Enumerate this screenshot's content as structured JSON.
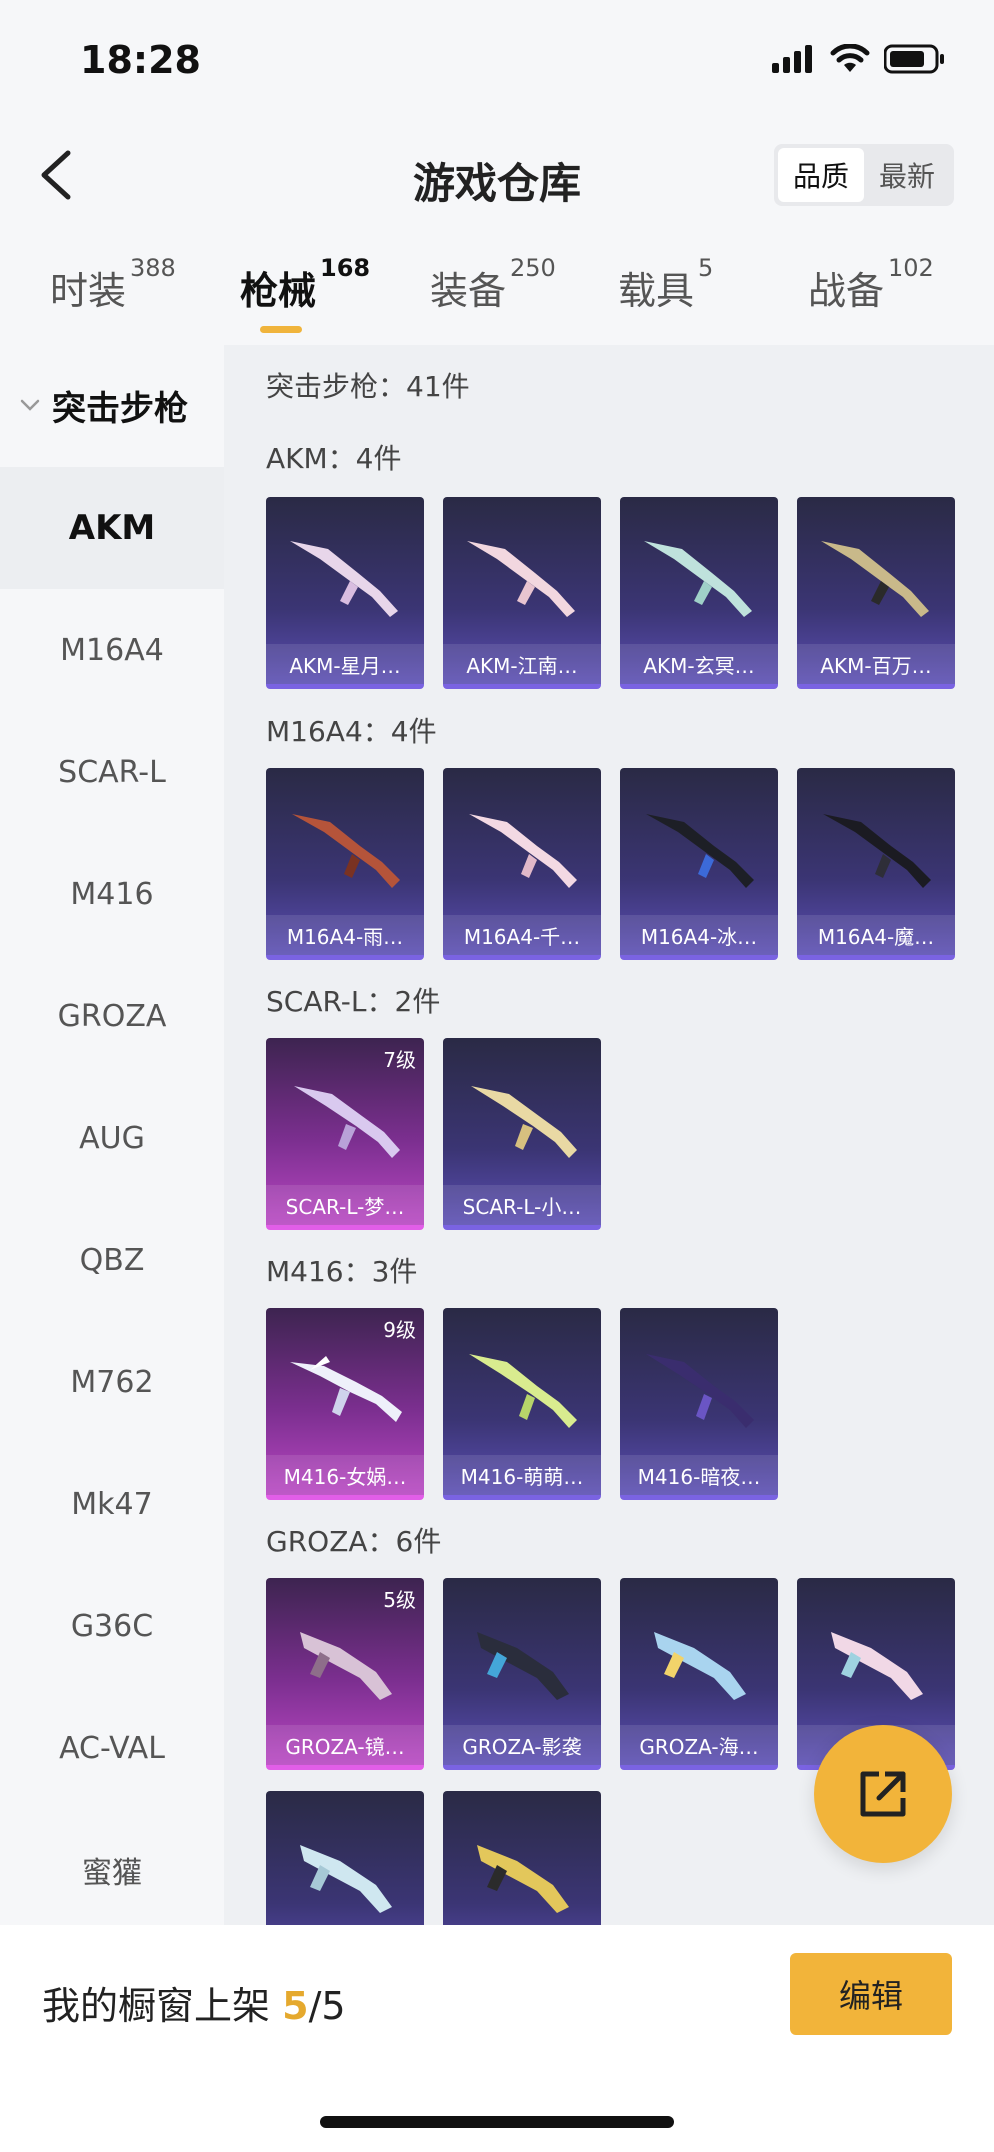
{
  "status_bar": {
    "time": "18:28",
    "icons": [
      "signal-icon",
      "wifi-icon",
      "battery-icon"
    ]
  },
  "header": {
    "title": "游戏仓库",
    "sort_options": [
      {
        "label": "品质",
        "active": true
      },
      {
        "label": "最新",
        "active": false
      }
    ]
  },
  "tabs": [
    {
      "label": "时装",
      "count": "388"
    },
    {
      "label": "枪械",
      "count": "168",
      "active": true
    },
    {
      "label": "装备",
      "count": "250"
    },
    {
      "label": "载具",
      "count": "5"
    },
    {
      "label": "战备",
      "count": "102"
    }
  ],
  "sidebar": {
    "group": "突击步枪",
    "items": [
      "AKM",
      "M16A4",
      "SCAR-L",
      "M416",
      "GROZA",
      "AUG",
      "QBZ",
      "M762",
      "Mk47",
      "G36C",
      "AC-VAL",
      "蜜獾"
    ],
    "active_index": 0
  },
  "main": {
    "total_label": "突击步枪：41件",
    "sections": [
      {
        "title": "AKM：4件",
        "items": [
          {
            "name": "AKM-星月…",
            "rarity": "blue"
          },
          {
            "name": "AKM-江南…",
            "rarity": "blue"
          },
          {
            "name": "AKM-玄冥…",
            "rarity": "blue"
          },
          {
            "name": "AKM-百万…",
            "rarity": "blue"
          }
        ]
      },
      {
        "title": "M16A4：4件",
        "items": [
          {
            "name": "M16A4-雨…",
            "rarity": "blue"
          },
          {
            "name": "M16A4-千…",
            "rarity": "blue"
          },
          {
            "name": "M16A4-冰…",
            "rarity": "blue"
          },
          {
            "name": "M16A4-魔…",
            "rarity": "blue"
          }
        ]
      },
      {
        "title": "SCAR-L：2件",
        "items": [
          {
            "name": "SCAR-L-梦…",
            "rarity": "purple",
            "level": "7级"
          },
          {
            "name": "SCAR-L-小…",
            "rarity": "blue"
          }
        ]
      },
      {
        "title": "M416：3件",
        "items": [
          {
            "name": "M416-女娲…",
            "rarity": "purple",
            "level": "9级"
          },
          {
            "name": "M416-萌萌…",
            "rarity": "blue"
          },
          {
            "name": "M416-暗夜…",
            "rarity": "blue"
          }
        ]
      },
      {
        "title": "GROZA：6件",
        "items": [
          {
            "name": "GROZA-镜…",
            "rarity": "purple",
            "level": "5级"
          },
          {
            "name": "GROZA-影袭",
            "rarity": "blue"
          },
          {
            "name": "GROZA-海…",
            "rarity": "blue"
          },
          {
            "name": "GR…",
            "rarity": "blue"
          },
          {
            "name": "",
            "rarity": "blue"
          },
          {
            "name": "",
            "rarity": "blue"
          }
        ]
      }
    ]
  },
  "bottom_bar": {
    "showcase_label": "我的橱窗上架",
    "showcase_current": "5",
    "showcase_separator": "/",
    "showcase_total": "5",
    "edit_label": "编辑"
  },
  "colors": {
    "accent": "#f2b43a",
    "blue_card": "#3b3574",
    "purple_card": "#7c2f90"
  },
  "fab_icon": "share-icon"
}
